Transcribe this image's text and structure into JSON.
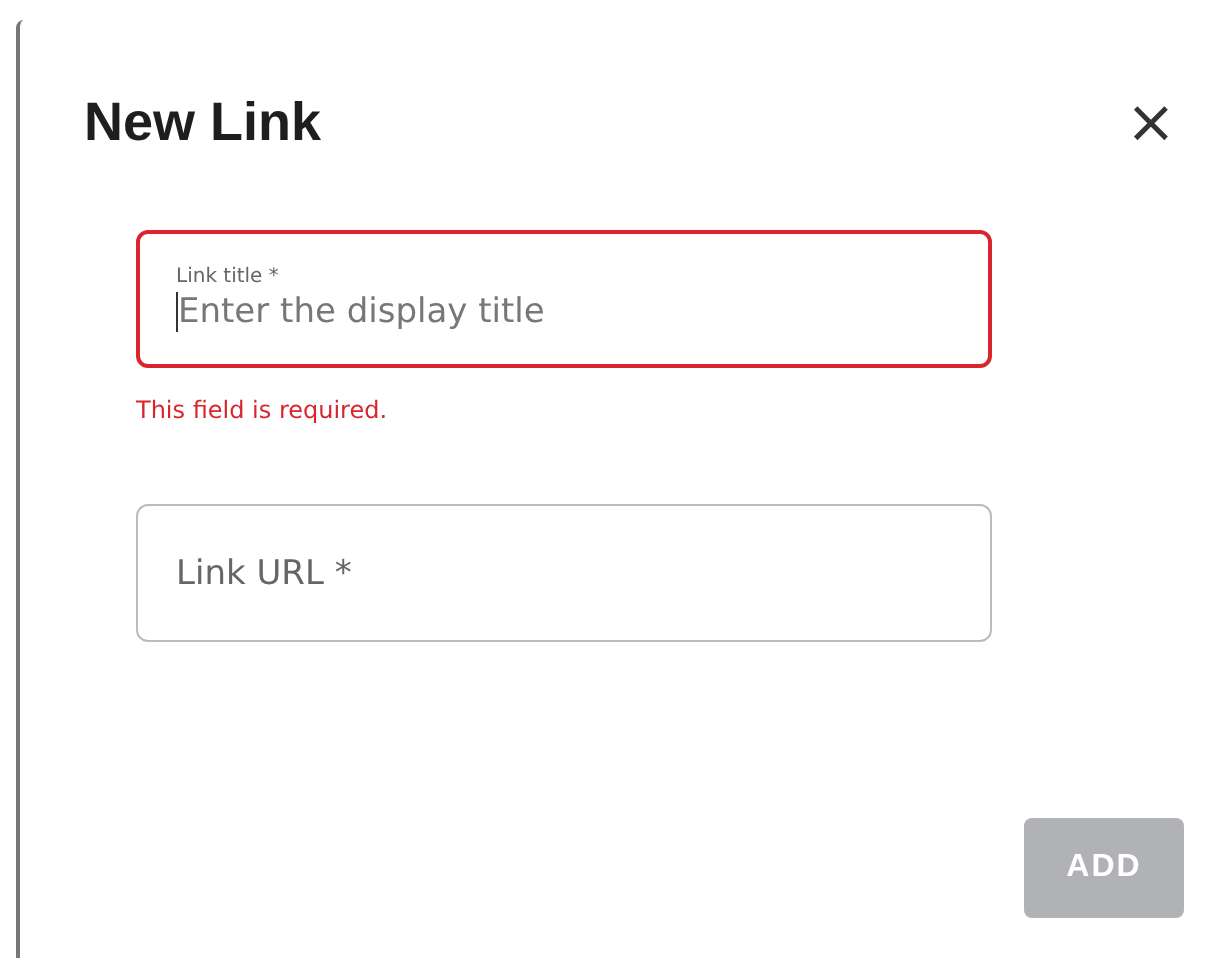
{
  "dialog": {
    "title": "New Link",
    "close_icon": "×"
  },
  "fields": [
    {
      "label": "Link title *",
      "placeholder": "Enter the display title",
      "focused": true,
      "invalid": true,
      "error": "This field is required."
    },
    {
      "label": "Link URL *",
      "focused": false,
      "invalid": false
    }
  ],
  "buttons": [
    {
      "label": "ADD",
      "disabled": true
    }
  ]
}
